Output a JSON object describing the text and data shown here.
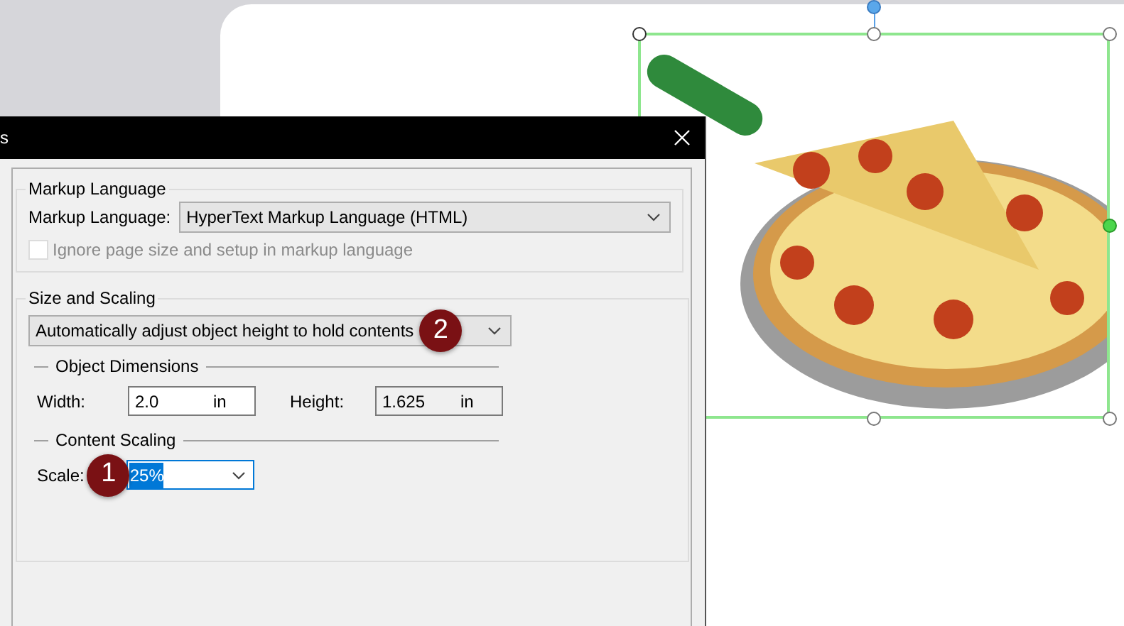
{
  "dialog": {
    "title": "s",
    "markup_group": {
      "legend": "Markup Language",
      "label": "Markup Language:",
      "value": "HyperText Markup Language (HTML)",
      "ignore_checkbox": {
        "label": "Ignore page size and setup in markup language",
        "checked": false,
        "disabled": true
      }
    },
    "size_group": {
      "legend": "Size and Scaling",
      "mode": "Automatically adjust object height to hold contents",
      "dimensions": {
        "heading": "Object Dimensions",
        "fields": [
          {
            "label": "Width:",
            "value": "2.0",
            "unit": "in",
            "disabled": false
          },
          {
            "label": "Height:",
            "value": "1.625",
            "unit": "in",
            "disabled": true
          }
        ]
      },
      "scaling": {
        "heading": "Content Scaling",
        "label": "Scale:",
        "value": "25%",
        "value_selected": true,
        "focused": true
      }
    }
  },
  "callouts": [
    {
      "number": "1"
    },
    {
      "number": "2"
    }
  ],
  "canvas": {
    "image": {
      "kind": "picture",
      "selected": true
    }
  }
}
